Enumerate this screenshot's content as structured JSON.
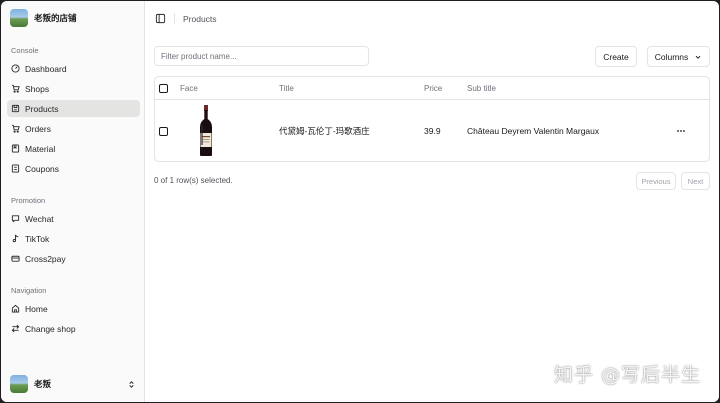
{
  "brand": {
    "name": "老叛的店铺"
  },
  "sidebar": {
    "groups": [
      {
        "label": "Console",
        "items": [
          {
            "label": "Dashboard",
            "icon": "gauge-icon"
          },
          {
            "label": "Shops",
            "icon": "cart-icon"
          },
          {
            "label": "Products",
            "icon": "products-icon",
            "active": true
          },
          {
            "label": "Orders",
            "icon": "orders-cart-icon"
          },
          {
            "label": "Material",
            "icon": "book-icon"
          },
          {
            "label": "Coupons",
            "icon": "ticket-icon"
          }
        ]
      },
      {
        "label": "Promotion",
        "items": [
          {
            "label": "Wechat",
            "icon": "message-icon"
          },
          {
            "label": "TikTok",
            "icon": "music-note-icon"
          },
          {
            "label": "Cross2pay",
            "icon": "credit-card-icon"
          }
        ]
      },
      {
        "label": "Navigation",
        "items": [
          {
            "label": "Home",
            "icon": "home-icon"
          },
          {
            "label": "Change shop",
            "icon": "swap-icon"
          }
        ]
      }
    ],
    "user": {
      "name": "老叛"
    }
  },
  "header": {
    "breadcrumb": "Products"
  },
  "toolbar": {
    "filter_placeholder": "Filter product name...",
    "filter_value": "",
    "create_label": "Create",
    "columns_label": "Columns"
  },
  "table": {
    "columns": [
      "Face",
      "Title",
      "Price",
      "Sub title"
    ],
    "rows": [
      {
        "title": "代黛姆-瓦伦丁-玛歌酒庄",
        "price": "39.9",
        "subtitle": "Château Deyrem Valentin Margaux"
      }
    ]
  },
  "footer": {
    "selected": "0 of 1 row(s) selected.",
    "previous": "Previous",
    "next": "Next"
  },
  "watermark": "知乎 @写后半生"
}
